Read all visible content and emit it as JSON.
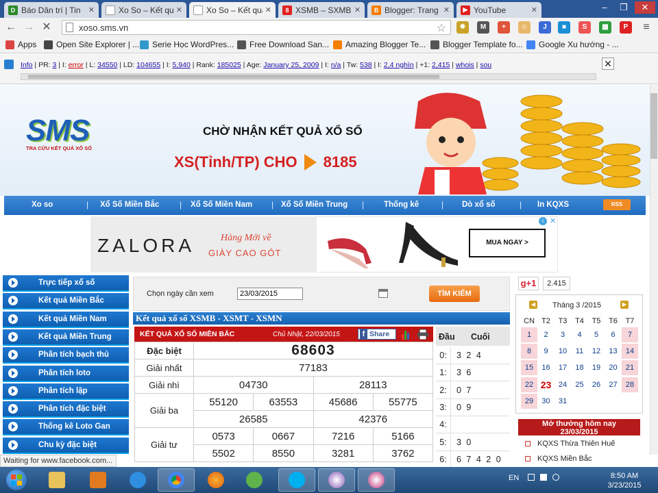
{
  "browser": {
    "tabs": [
      {
        "label": "Báo Dân trí | Tin",
        "fav": "D",
        "color": "#2a8a2a"
      },
      {
        "label": "Xo So – Kết quả",
        "fav": "",
        "color": "#ffffff"
      },
      {
        "label": "Xo So – Kết quả",
        "fav": "",
        "color": "#ffffff"
      },
      {
        "label": "XSMB – SXMB –",
        "fav": "8",
        "color": "#e02020"
      },
      {
        "label": "Blogger: Trang",
        "fav": "B",
        "color": "#f57d00"
      },
      {
        "label": "YouTube",
        "fav": "▶",
        "color": "#e02020"
      }
    ],
    "url": "xoso.sms.vn",
    "bookmarks": [
      {
        "label": "Apps",
        "color": "#d44"
      },
      {
        "label": "Open Site Explorer | ...",
        "color": "#444"
      },
      {
        "label": "Serie Học WordPres...",
        "color": "#39c"
      },
      {
        "label": "Free Download San...",
        "color": "#555"
      },
      {
        "label": "Amazing Blogger Te...",
        "color": "#f57d00"
      },
      {
        "label": "Blogger Template fo...",
        "color": "#555"
      },
      {
        "label": "Google Xu hướng - ...",
        "color": "#4285f4"
      }
    ],
    "seo": {
      "info": "Info",
      "pr_label": "PR:",
      "pr": "3",
      "i_label": "I:",
      "i": "error",
      "l_label": "L:",
      "l": "34550",
      "ld_label": "LD:",
      "ld": "104655",
      "i2_label": "I:",
      "i2": "5,940",
      "rank_label": "Rank:",
      "rank": "185025",
      "age_label": "Age:",
      "age": "January 25, 2009",
      "i3_label": "I:",
      "i3": "n/a",
      "tw_label": "Tw:",
      "tw": "538",
      "i4_label": "I:",
      "i4": "2,4 nghìn",
      "gp_label": "+1:",
      "gp": "2,415",
      "whois": "whois",
      "sou": "sou"
    },
    "status": "Waiting for www.facebook.com..."
  },
  "site": {
    "logo_text": "SMS",
    "logo_sub": "TRA CỨU KẾT QUẢ XỔ SỐ",
    "headline": "CHỜ NHẬN KẾT QUẢ XỔ SỐ",
    "sms_left": "XS(Tỉnh/TP) CHO",
    "sms_number": "8185",
    "nav": [
      "Xo so",
      "Xổ Số Miền Bắc",
      "Xổ Số Miền Nam",
      "Xổ Số Miền Trung",
      "Thống kê",
      "Dò xổ số",
      "In KQXS"
    ],
    "rss": "RSS",
    "ad": {
      "brand": "ZALORA",
      "line1": "Hàng Mới về",
      "line2": "GIÀY CAO GÓT",
      "cta": "MUA NGAY >"
    },
    "left_menu": [
      "Trực tiếp xổ số",
      "Kết quả Miền Bắc",
      "Kết quả Miền Nam",
      "Kết quả Miền Trung",
      "Phân tích bạch thủ",
      "Phân tích loto",
      "Phân tích lặp",
      "Phân tích đặc biệt",
      "Thống kê Loto Gan",
      "Chu kỳ đặc biệt"
    ],
    "search": {
      "label": "Chọn ngày cần xem",
      "date": "23/03/2015",
      "button": "TÌM KIẾM"
    },
    "section_title": "Kết quả xổ số XSMB - XSMT - XSMN",
    "mb": {
      "title": "KẾT QUẢ XỔ SỐ MIỀN BẮC",
      "date": "Chủ Nhật, 22/03/2015",
      "share": "Share",
      "labels": {
        "db": "Đặc biệt",
        "g1": "Giải nhất",
        "g2": "Giải nhì",
        "g3": "Giải ba",
        "g4": "Giải tư"
      },
      "db": "68603",
      "g1": "77183",
      "g2": [
        "04730",
        "28113"
      ],
      "g3a": [
        "55120",
        "63553",
        "45686",
        "55775"
      ],
      "g3b": [
        "26585",
        "42376"
      ],
      "g4a": [
        "0573",
        "0667",
        "7216",
        "5166"
      ],
      "g4b": [
        "5502",
        "8550",
        "3281",
        "3762"
      ]
    },
    "dc": {
      "dau": "Đầu",
      "cuoi": "Cuối",
      "rows": [
        {
          "d": "0:",
          "c": "3 2 4"
        },
        {
          "d": "1:",
          "c": "3 6"
        },
        {
          "d": "2:",
          "c": "0 7"
        },
        {
          "d": "3:",
          "c": "0 9"
        },
        {
          "d": "4:",
          "c": ""
        },
        {
          "d": "5:",
          "c": "3 0"
        },
        {
          "d": "6:",
          "c": "6 7 4 2 0"
        }
      ]
    },
    "gplus": {
      "label": "g+1",
      "count": "2.415"
    },
    "calendar": {
      "month": "Tháng 3 /2015",
      "days": [
        "CN",
        "T2",
        "T3",
        "T4",
        "T5",
        "T6",
        "T7"
      ],
      "weeks": [
        [
          "1",
          "2",
          "3",
          "4",
          "5",
          "6",
          "7"
        ],
        [
          "8",
          "9",
          "10",
          "11",
          "12",
          "13",
          "14"
        ],
        [
          "15",
          "16",
          "17",
          "18",
          "19",
          "20",
          "21"
        ],
        [
          "22",
          "23",
          "24",
          "25",
          "26",
          "27",
          "28"
        ],
        [
          "29",
          "30",
          "31",
          "",
          "",
          "",
          ""
        ]
      ]
    },
    "mo_thuong": {
      "title": "Mở thưởng hôm nay",
      "date": "23/03/2015",
      "items": [
        "KQXS Thừa Thiên Huế",
        "KQXS Miền Bắc"
      ]
    }
  },
  "taskbar": {
    "lang": "EN",
    "time": "8:50 AM",
    "date": "3/23/2015"
  }
}
